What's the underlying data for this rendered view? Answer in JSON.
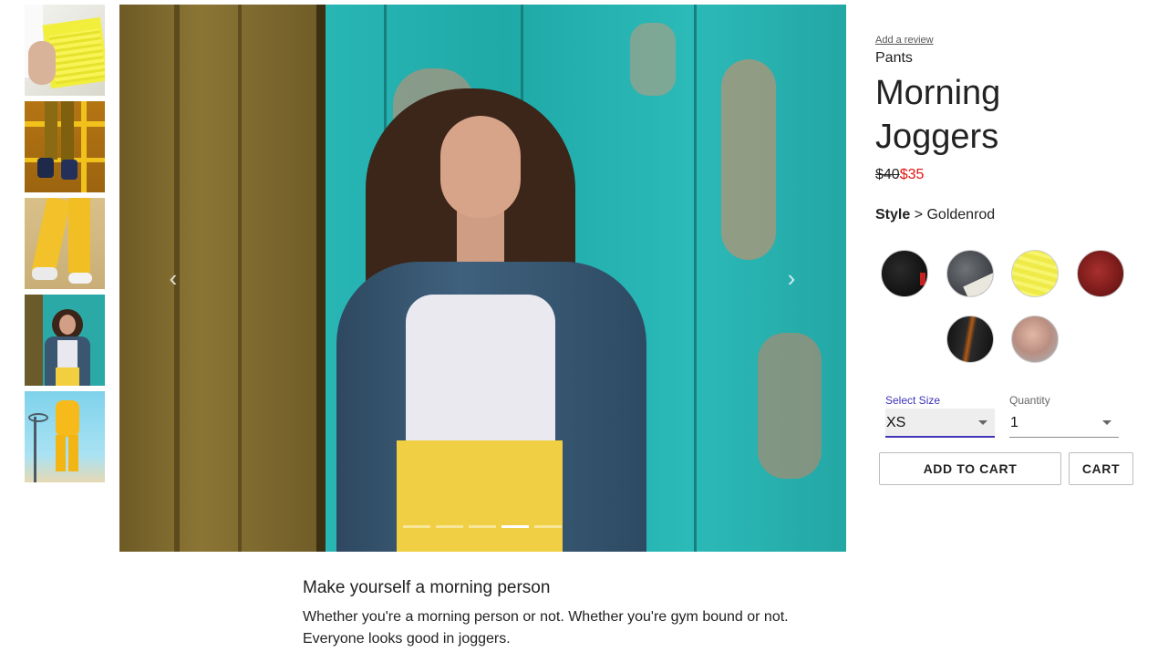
{
  "thumbnails": [
    {
      "label": "thumbnail-1",
      "active": false
    },
    {
      "label": "thumbnail-2",
      "active": false
    },
    {
      "label": "thumbnail-3",
      "active": false
    },
    {
      "label": "thumbnail-4",
      "active": true
    },
    {
      "label": "thumbnail-5",
      "active": false
    }
  ],
  "carousel": {
    "prev_glyph": "‹",
    "next_glyph": "›",
    "indicator_count": 5,
    "active_indicator": 4
  },
  "product": {
    "review_link": "Add a review",
    "category": "Pants",
    "name": "Morning Joggers",
    "original_price": "$40",
    "sale_price": "$35",
    "style_label": "Style",
    "style_separator": " > ",
    "selected_style": "Goldenrod"
  },
  "styles": [
    {
      "name": "black",
      "color": "#111111"
    },
    {
      "name": "gray",
      "color": "#4a4d52"
    },
    {
      "name": "yellow",
      "color": "#f1ed55"
    },
    {
      "name": "maroon",
      "color": "#8b2020"
    },
    {
      "name": "black-orange",
      "color": "#1c1c1c"
    },
    {
      "name": "pink",
      "color": "#d4a99a"
    }
  ],
  "size": {
    "label": "Select Size",
    "value": "XS"
  },
  "quantity": {
    "label": "Quantity",
    "value": "1"
  },
  "buttons": {
    "add_to_cart": "ADD TO CART",
    "cart": "CART"
  },
  "description": {
    "heading": "Make yourself a morning person",
    "body": "Whether you're a morning person or not. Whether you're gym bound or not. Everyone looks good in joggers."
  },
  "colors": {
    "accent": "#3f33b8",
    "sale": "#e4130f"
  }
}
